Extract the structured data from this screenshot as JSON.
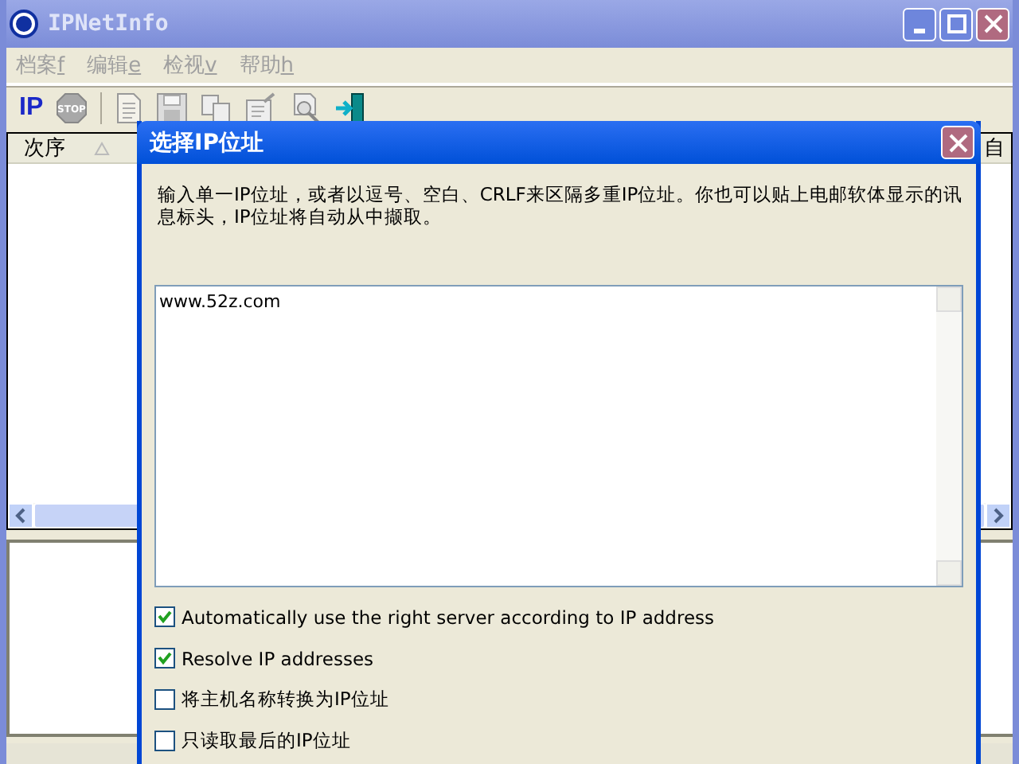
{
  "window": {
    "title": "IPNetInfo",
    "active": false
  },
  "menu": [
    {
      "label": "档案",
      "key": "f"
    },
    {
      "label": "编辑",
      "key": "e"
    },
    {
      "label": "检视",
      "key": "v"
    },
    {
      "label": "帮助",
      "key": "h"
    }
  ],
  "toolbar": [
    {
      "kind": "ip",
      "label": "IP"
    },
    {
      "kind": "stop",
      "label": "STOP"
    },
    {
      "kind": "sep"
    },
    {
      "kind": "doc"
    },
    {
      "kind": "save"
    },
    {
      "kind": "copy"
    },
    {
      "kind": "props"
    },
    {
      "kind": "find"
    },
    {
      "kind": "exit"
    }
  ],
  "table": {
    "columns": [
      {
        "label": "次序",
        "sorted": true
      },
      {
        "label": "自"
      }
    ]
  },
  "dialog": {
    "title": "选择IP位址",
    "instructions": "输入单一IP位址，或者以逗号、空白、CRLF来区隔多重IP位址。你也可以贴上电邮软体显示的讯息标头，IP位址将自动从中撷取。",
    "input": {
      "value": "www.52z.com"
    },
    "options": [
      {
        "label": "Automatically use the right server according to IP address",
        "checked": true
      },
      {
        "label": "Resolve IP addresses",
        "checked": true
      },
      {
        "label": "将主机名称转换为IP位址",
        "checked": false
      },
      {
        "label": "只读取最后的IP位址",
        "checked": false
      }
    ]
  }
}
